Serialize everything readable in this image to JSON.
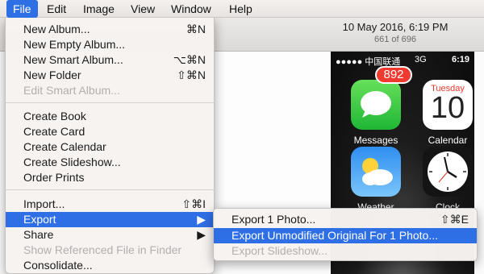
{
  "menubar": {
    "items": [
      "File",
      "Edit",
      "Image",
      "View",
      "Window",
      "Help"
    ]
  },
  "header": {
    "date": "10 May 2016, 6:19 PM",
    "count": "661 of 696"
  },
  "phone": {
    "carrier": "●●●●● 中国联通",
    "network": "3G",
    "time": "6:19",
    "badge": "892",
    "apps": [
      {
        "label": "Messages",
        "icon": "messages-icon"
      },
      {
        "label": "Calendar",
        "icon": "calendar-icon",
        "day": "Tuesday",
        "date": "10"
      },
      {
        "label": "Weather",
        "icon": "weather-icon"
      },
      {
        "label": "Clock",
        "icon": "clock-icon"
      }
    ]
  },
  "file_menu": {
    "new_album": "New Album...",
    "new_album_sc": "⌘N",
    "new_empty_album": "New Empty Album...",
    "new_smart_album": "New Smart Album...",
    "new_smart_album_sc": "⌥⌘N",
    "new_folder": "New Folder",
    "new_folder_sc": "⇧⌘N",
    "edit_smart_album": "Edit Smart Album...",
    "create_book": "Create Book",
    "create_card": "Create Card",
    "create_calendar": "Create Calendar",
    "create_slideshow": "Create Slideshow...",
    "order_prints": "Order Prints",
    "import": "Import...",
    "import_sc": "⇧⌘I",
    "export": "Export",
    "share": "Share",
    "show_referenced": "Show Referenced File in Finder",
    "consolidate": "Consolidate...",
    "arrow": "▶"
  },
  "export_submenu": {
    "export_photo": "Export 1 Photo...",
    "export_photo_sc": "⇧⌘E",
    "export_unmodified": "Export Unmodified Original For 1 Photo...",
    "export_slideshow": "Export Slideshow..."
  }
}
